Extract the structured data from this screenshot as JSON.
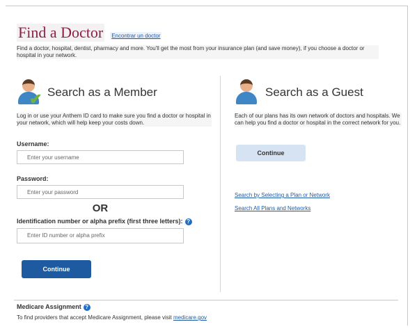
{
  "header": {
    "title": "Find a Doctor",
    "language_link": "Encontrar un doctor",
    "intro": "Find a doctor, hospital, dentist, pharmacy and more. You'll get the most from your insurance plan (and save money), if you choose a doctor or hospital in your network."
  },
  "member": {
    "icon": "member-avatar-check-icon",
    "title": "Search as a Member",
    "description": "Log in or use your Anthem ID card to make sure you find a doctor or hospital in your network, which will help keep your costs down.",
    "username_label": "Username:",
    "username_placeholder": "Enter your username",
    "password_label": "Password:",
    "password_placeholder": "Enter your password",
    "or_text": "OR",
    "id_label": "Identification number or alpha prefix (first three letters):",
    "id_placeholder": "Enter ID number or alpha prefix",
    "continue_label": "Continue"
  },
  "guest": {
    "icon": "guest-avatar-icon",
    "title": "Search as a Guest",
    "description": "Each of our plans has its own network of doctors and hospitals. We can help you find a doctor or hospital in the correct network for you.",
    "continue_label": "Continue",
    "links": [
      "Search by Selecting a Plan or Network",
      "Search All Plans and Networks"
    ]
  },
  "medicare": {
    "title": "Medicare Assignment",
    "text": "To find providers that accept Medicare Assignment, please visit",
    "link": "medicare.gov"
  },
  "colors": {
    "brand": "#8a2046",
    "primary_button": "#1e5aa0",
    "secondary_button": "#d6e3f3",
    "link": "#1f5aa6"
  }
}
